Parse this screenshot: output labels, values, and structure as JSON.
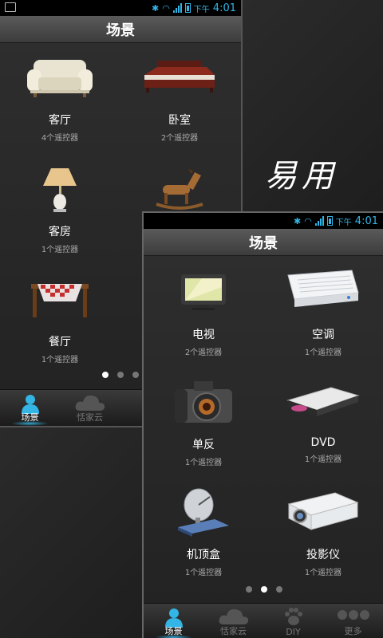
{
  "slogan": "易用",
  "status_bar": {
    "ampm": "下午",
    "time": "4:01"
  },
  "screen1": {
    "title": "场景",
    "items": [
      {
        "name": "客厅",
        "count": "4个遥控器"
      },
      {
        "name": "卧室",
        "count": "2个遥控器"
      },
      {
        "name": "客房",
        "count": "1个遥控器"
      },
      {
        "name": "餐厅",
        "count": "1个遥控器"
      }
    ],
    "tabs": [
      {
        "label": "场景"
      },
      {
        "label": "恬家云"
      }
    ]
  },
  "screen2": {
    "title": "场景",
    "items": [
      {
        "name": "电视",
        "count": "2个遥控器"
      },
      {
        "name": "空调",
        "count": "1个遥控器"
      },
      {
        "name": "单反",
        "count": "1个遥控器"
      },
      {
        "name": "DVD",
        "count": "1个遥控器"
      },
      {
        "name": "机顶盒",
        "count": "1个遥控器"
      },
      {
        "name": "投影仪",
        "count": "1个遥控器"
      }
    ],
    "tabs": [
      {
        "label": "场景"
      },
      {
        "label": "恬家云"
      },
      {
        "label": "DIY"
      },
      {
        "label": "更多"
      }
    ]
  },
  "colors": {
    "accent": "#33b5e5",
    "status_bar": "#000000"
  }
}
